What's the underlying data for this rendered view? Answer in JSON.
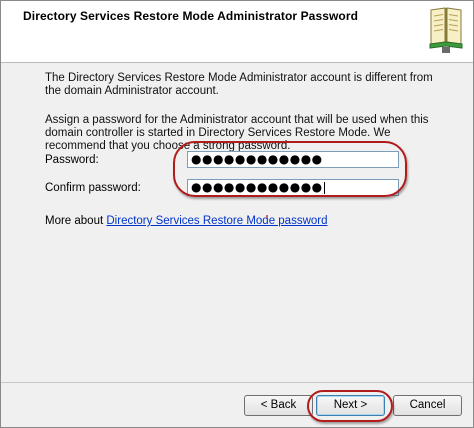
{
  "header": {
    "title": "Directory Services Restore Mode Administrator Password",
    "icon": "book-icon"
  },
  "body": {
    "para1": "The Directory Services Restore Mode Administrator account is different from the domain Administrator account.",
    "para2": "Assign a password for the Administrator account that will be used when this domain controller is started in Directory Services Restore Mode. We recommend that you choose a strong password."
  },
  "fields": {
    "password_label": "Password:",
    "password_value": "●●●●●●●●●●●●",
    "confirm_label": "Confirm password:",
    "confirm_value": "●●●●●●●●●●●●"
  },
  "more": {
    "prefix": "More about ",
    "link": "Directory Services Restore Mode password"
  },
  "buttons": {
    "back": "< Back",
    "next": "Next >",
    "cancel": "Cancel"
  },
  "colors": {
    "annotation": "#b01c1c",
    "link": "#0033cc"
  }
}
